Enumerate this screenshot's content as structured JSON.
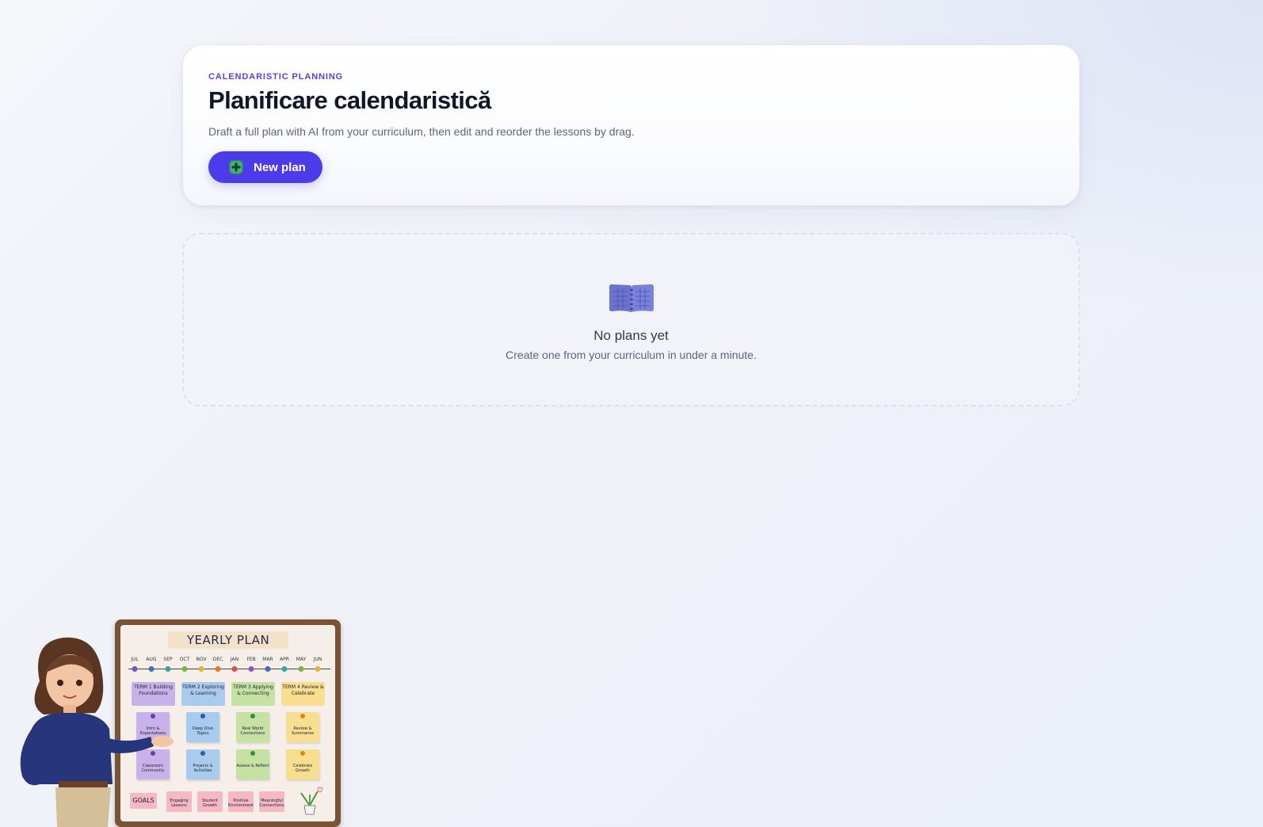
{
  "header": {
    "eyebrow": "CALENDARISTIC PLANNING",
    "title": "Planificare calendaristică",
    "subtitle": "Draft a full plan with AI from your curriculum, then edit and reorder the lessons by drag.",
    "new_plan_label": "New plan",
    "new_plan_icon": "plus-icon"
  },
  "empty_state": {
    "icon": "book-icon",
    "title": "No plans yet",
    "subtitle": "Create one from your curriculum in under a minute."
  },
  "illustration": {
    "board_title": "YEARLY PLAN",
    "months": [
      "JUL",
      "AUG",
      "SEP",
      "OCT",
      "NOV",
      "DEC",
      "JAN",
      "FEB",
      "MAR",
      "APR",
      "MAY",
      "JUN"
    ],
    "terms": [
      {
        "name": "TERM 1",
        "label": "Building Foundations",
        "color": "#c9b1ea"
      },
      {
        "name": "TERM 2",
        "label": "Exploring & Learning",
        "color": "#a9cbee"
      },
      {
        "name": "TERM 3",
        "label": "Applying & Connecting",
        "color": "#c6e2a3"
      },
      {
        "name": "TERM 4",
        "label": "Review & Celebrate",
        "color": "#f8de8f"
      }
    ],
    "notes": [
      "Intro & Expectations",
      "Deep Dive Topics",
      "Real World Connections",
      "Review & Summaries",
      "Classroom Community",
      "Projects & Activities",
      "Assess & Reflect",
      "Celebrate Growth"
    ],
    "goals_label": "GOALS",
    "goals": [
      "Engaging Lessons",
      "Student Growth",
      "Positive Environment",
      "Meaningful Connections"
    ]
  },
  "colors": {
    "accent": "#4c3bea",
    "eyebrow": "#4f46e5",
    "title": "#131628",
    "muted": "#5f6478"
  }
}
